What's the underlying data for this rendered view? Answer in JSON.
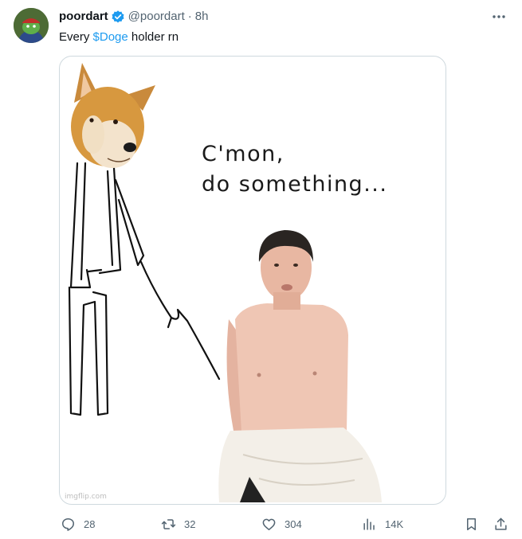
{
  "author": {
    "display_name": "poordart",
    "handle": "@poordart",
    "separator": "·",
    "time": "8h",
    "verified": true
  },
  "tweet": {
    "text_before": "Every ",
    "cashtag": "$Doge",
    "text_after": " holder rn"
  },
  "media": {
    "caption": "C'mon,\ndo something...",
    "watermark": "imgflip.com"
  },
  "actions": {
    "replies": "28",
    "retweets": "32",
    "likes": "304",
    "views": "14K"
  },
  "icons": {
    "more": "more-icon",
    "reply": "reply-icon",
    "retweet": "retweet-icon",
    "like": "heart-icon",
    "views": "views-icon",
    "bookmark": "bookmark-icon",
    "share": "share-icon",
    "verified": "verified-badge-icon"
  },
  "colors": {
    "accent": "#1d9bf0",
    "secondary_text": "#536471",
    "border": "#cfd9de"
  }
}
